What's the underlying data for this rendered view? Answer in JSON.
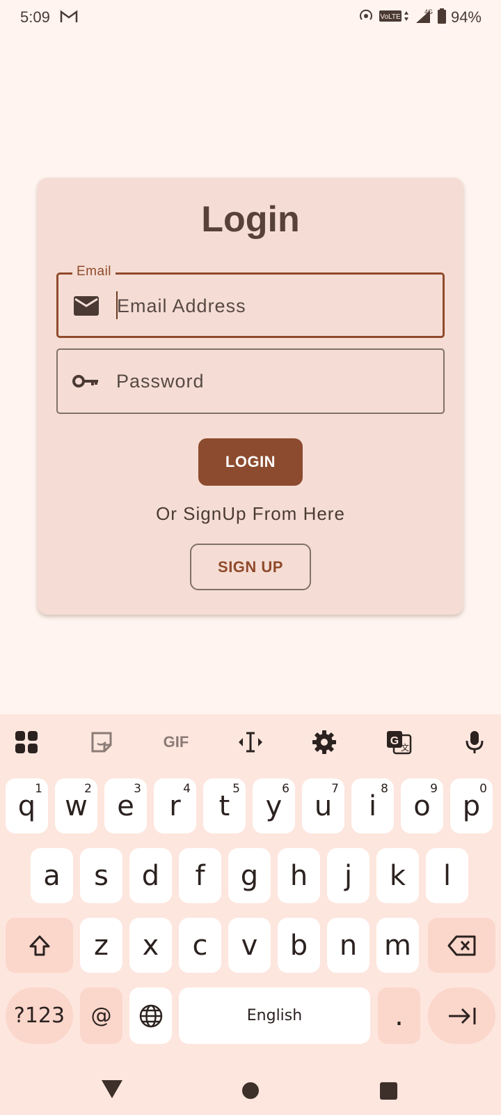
{
  "status_bar": {
    "time": "5:09",
    "battery": "94%",
    "network": "4G",
    "volte": "VoLTE",
    "icons": [
      "gmail-icon",
      "hotspot-icon",
      "volte-icon",
      "signal-icon",
      "battery-icon"
    ]
  },
  "login": {
    "title": "Login",
    "email_label": "Email",
    "email_placeholder": "Email Address",
    "password_placeholder": "Password",
    "login_button": "LOGIN",
    "or_text": "Or SignUp From Here",
    "signup_button": "SIGN UP"
  },
  "keyboard": {
    "toolbar": [
      "apps-grid-icon",
      "sticker-icon",
      "gif-icon",
      "text-cursor-icon",
      "settings-icon",
      "translate-icon",
      "microphone-icon"
    ],
    "gif_label": "GIF",
    "row1": [
      {
        "key": "q",
        "hint": "1"
      },
      {
        "key": "w",
        "hint": "2"
      },
      {
        "key": "e",
        "hint": "3"
      },
      {
        "key": "r",
        "hint": "4"
      },
      {
        "key": "t",
        "hint": "5"
      },
      {
        "key": "y",
        "hint": "6"
      },
      {
        "key": "u",
        "hint": "7"
      },
      {
        "key": "i",
        "hint": "8"
      },
      {
        "key": "o",
        "hint": "9"
      },
      {
        "key": "p",
        "hint": "0"
      }
    ],
    "row2": [
      "a",
      "s",
      "d",
      "f",
      "g",
      "h",
      "j",
      "k",
      "l"
    ],
    "row3": [
      "z",
      "x",
      "c",
      "v",
      "b",
      "n",
      "m"
    ],
    "symbols_key": "?123",
    "at_key": "@",
    "space_label": "English",
    "period_key": "."
  },
  "colors": {
    "accent": "#8c4b2e",
    "card": "#f5ddd5",
    "background": "#fff4ef",
    "keyboard": "#fde6de"
  }
}
